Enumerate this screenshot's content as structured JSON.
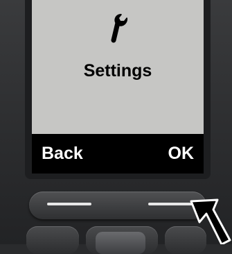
{
  "display": {
    "icon": "wrench-icon",
    "title": "Settings"
  },
  "softkeys": {
    "left_label": "Back",
    "right_label": "OK"
  },
  "colors": {
    "screen": "#c6c6c4",
    "softkey_bar": "#000000",
    "housing": "#2a2b2d"
  }
}
